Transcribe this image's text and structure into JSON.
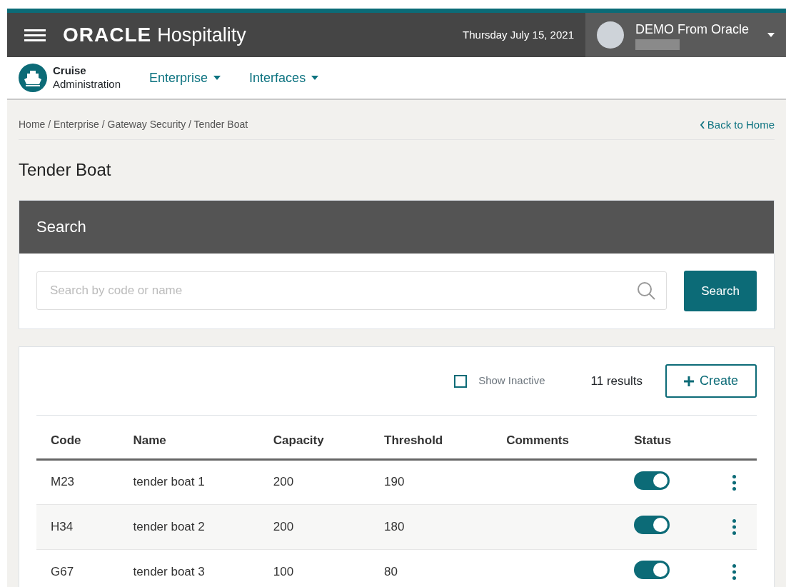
{
  "header": {
    "brand": "ORACLE",
    "product": "Hospitality",
    "date": "Thursday July 15, 2021",
    "user": "DEMO From Oracle"
  },
  "app": {
    "title": "Cruise",
    "subtitle": "Administration"
  },
  "nav": [
    {
      "label": "Enterprise"
    },
    {
      "label": "Interfaces"
    }
  ],
  "breadcrumb": "Home / Enterprise / Gateway Security / Tender Boat",
  "back_link": "Back to Home",
  "page_title": "Tender Boat",
  "search": {
    "heading": "Search",
    "placeholder": "Search by code or name",
    "button": "Search"
  },
  "results": {
    "show_inactive": {
      "label": "Show Inactive",
      "checked": false
    },
    "count": "11 results",
    "create": "Create"
  },
  "table": {
    "columns": [
      "Code",
      "Name",
      "Capacity",
      "Threshold",
      "Comments",
      "Status"
    ],
    "rows": [
      {
        "code": "M23",
        "name": "tender boat 1",
        "capacity": "200",
        "threshold": "190",
        "active": true
      },
      {
        "code": "H34",
        "name": "tender boat 2",
        "capacity": "200",
        "threshold": "180",
        "active": true
      },
      {
        "code": "G67",
        "name": "tender boat 3",
        "capacity": "100",
        "threshold": "80",
        "active": true
      }
    ]
  }
}
